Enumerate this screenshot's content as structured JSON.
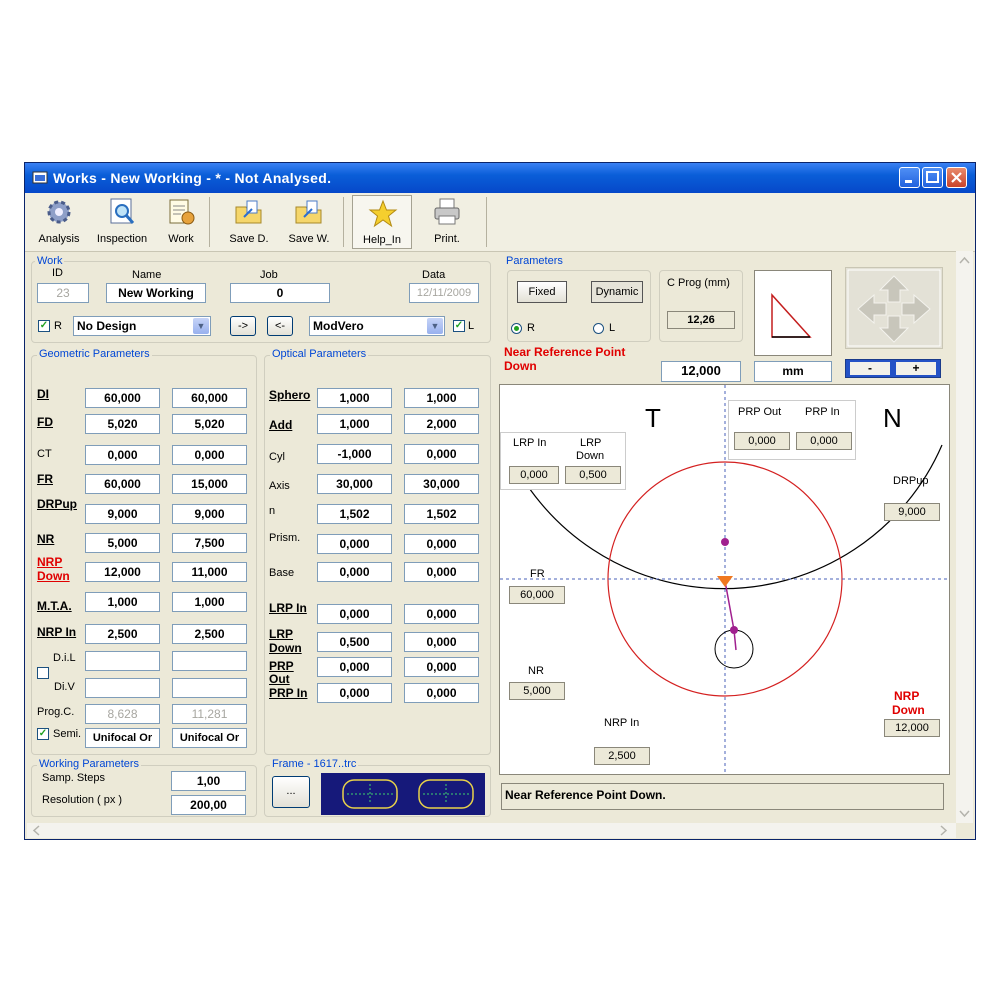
{
  "window": {
    "title": "Works - New Working - * - Not Analysed."
  },
  "toolbar": {
    "analysis": "Analysis",
    "inspection": "Inspection",
    "work": "Work",
    "save_d": "Save D.",
    "save_w": "Save W.",
    "help_in": "Help_In",
    "print": "Print."
  },
  "work": {
    "group_title": "Work",
    "id_label": "ID",
    "id_value": "23",
    "name_label": "Name",
    "name_value": "New Working",
    "job_label": "Job",
    "job_value": "0",
    "data_label": "Data",
    "data_value": "12/11/2009",
    "r_label": "R",
    "design_value": "No Design",
    "copy_right": "->",
    "copy_left": "<-",
    "model_value": "ModVero",
    "l_label": "L"
  },
  "geometric": {
    "title": "Geometric Parameters",
    "di": {
      "label": "DI",
      "r": "60,000",
      "l": "60,000"
    },
    "fd": {
      "label": "FD",
      "r": "5,020",
      "l": "5,020"
    },
    "ct": {
      "label": "CT",
      "r": "0,000",
      "l": "0,000"
    },
    "fr": {
      "label": "FR",
      "r": "60,000",
      "l": "15,000"
    },
    "drpup": {
      "label": "DRPup",
      "r": "9,000",
      "l": "9,000"
    },
    "nr": {
      "label": "NR",
      "r": "5,000",
      "l": "7,500"
    },
    "nrp_down": {
      "label1": "NRP",
      "label2": "Down",
      "r": "12,000",
      "l": "11,000"
    },
    "mta": {
      "label": "M.T.A.",
      "r": "1,000",
      "l": "1,000"
    },
    "nrp_in": {
      "label": "NRP In",
      "r": "2,500",
      "l": "2,500"
    },
    "dil_label": "D.i.L",
    "div_label": "Di.V",
    "progc": {
      "label": "Prog.C.",
      "r": "8,628",
      "l": "11,281"
    },
    "semi": {
      "label": "Semi.",
      "r": "Unifocal Or",
      "l": "Unifocal Or"
    }
  },
  "optical": {
    "title": "Optical Parameters",
    "sphero": {
      "label": "Sphero",
      "r": "1,000",
      "l": "1,000"
    },
    "add": {
      "label": "Add",
      "r": "1,000",
      "l": "2,000"
    },
    "cyl": {
      "label": "Cyl",
      "r": "-1,000",
      "l": "0,000"
    },
    "axis": {
      "label": "Axis",
      "r": "30,000",
      "l": "30,000"
    },
    "n": {
      "label": "n",
      "r": "1,502",
      "l": "1,502"
    },
    "prism": {
      "label": "Prism.",
      "r": "0,000",
      "l": "0,000"
    },
    "base": {
      "label": "Base",
      "r": "0,000",
      "l": "0,000"
    },
    "lrp_in": {
      "label": "LRP In",
      "r": "0,000",
      "l": "0,000"
    },
    "lrp_down": {
      "label1": "LRP",
      "label2": "Down",
      "r": "0,500",
      "l": "0,000"
    },
    "prp_out": {
      "label1": "PRP",
      "label2": "Out",
      "r": "0,000",
      "l": "0,000"
    },
    "prp_in": {
      "label": "PRP In",
      "r": "0,000",
      "l": "0,000"
    }
  },
  "working_params": {
    "title": "Working Parameters",
    "samp_label": "Samp. Steps",
    "samp_value": "1,00",
    "res_label": "Resolution ( px )",
    "res_value": "200,00"
  },
  "frame": {
    "title": "Frame - 1617..trc",
    "browse_label": "..."
  },
  "parameters": {
    "title": "Parameters",
    "fixed": "Fixed",
    "dynamic": "Dynamic",
    "r_label": "R",
    "l_label": "L",
    "cprog_label": "C Prog  (mm)",
    "cprog_value": "12,26",
    "active_line1": "Near Reference Point",
    "active_line2": "Down",
    "value": "12,000",
    "unit": "mm",
    "minus": "-",
    "plus": "+"
  },
  "canvas": {
    "t_label": "T",
    "n_label": "N",
    "prp_out_label": "PRP Out",
    "prp_out_value": "0,000",
    "prp_in_label": "PRP In",
    "prp_in_value": "0,000",
    "lrp_in_label": "LRP In",
    "lrp_in_value": "0,000",
    "lrp_down_label1": "LRP",
    "lrp_down_label2": "Down",
    "lrp_down_value": "0,500",
    "drpup_label": "DRPup",
    "drpup_value": "9,000",
    "fr_label": "FR",
    "fr_value": "60,000",
    "nr_label": "NR",
    "nr_value": "5,000",
    "nrp_in_label": "NRP In",
    "nrp_in_value": "2,500",
    "nrp_down_label1": "NRP",
    "nrp_down_label2": "Down",
    "nrp_down_value": "12,000"
  },
  "status": {
    "text": "Near Reference Point Down."
  },
  "colors": {
    "accent_blue": "#0046d5",
    "highlight_red": "#e00000",
    "circle_red": "#d42020",
    "point_magenta": "#a0208f",
    "marker_orange": "#f07820"
  }
}
